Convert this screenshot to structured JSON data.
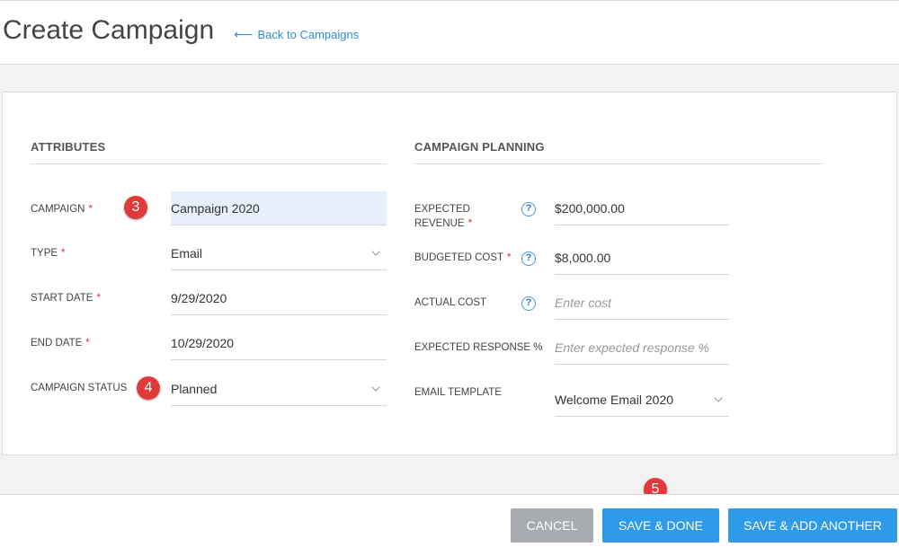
{
  "header": {
    "title": "Create Campaign",
    "back_arrow": "⟵",
    "back_label": "Back to Campaigns"
  },
  "attributes": {
    "section_title": "ATTRIBUTES",
    "required_mark": "*",
    "campaign": {
      "label": "CAMPAIGN",
      "value": "Campaign 2020"
    },
    "type": {
      "label": "TYPE",
      "value": "Email"
    },
    "start_date": {
      "label": "START DATE",
      "value": "9/29/2020"
    },
    "end_date": {
      "label": "END DATE",
      "value": "10/29/2020"
    },
    "campaign_status": {
      "label": "CAMPAIGN STATUS",
      "value": "Planned"
    }
  },
  "planning": {
    "section_title": "CAMPAIGN PLANNING",
    "help_glyph": "?",
    "expected_revenue": {
      "label_line1": "EXPECTED",
      "label_line2": "REVENUE",
      "value": "$200,000.00"
    },
    "budgeted_cost": {
      "label": "BUDGETED COST",
      "value": "$8,000.00"
    },
    "actual_cost": {
      "label": "ACTUAL COST",
      "placeholder": "Enter cost"
    },
    "expected_response": {
      "label": "EXPECTED RESPONSE %",
      "placeholder": "Enter expected response %"
    },
    "email_template": {
      "label": "EMAIL TEMPLATE",
      "value": "Welcome Email 2020"
    }
  },
  "badges": {
    "b3": "3",
    "b4": "4",
    "b5": "5"
  },
  "footer": {
    "cancel_label": "CANCEL",
    "save_done_label": "SAVE & DONE",
    "save_another_label": "SAVE & ADD ANOTHER"
  },
  "colors": {
    "accent": "#2f9be8",
    "link": "#2e8fd8",
    "badge": "#e23a3a",
    "required": "#e0303a",
    "highlight": "#e7effc"
  },
  "icons": {
    "back": "arrow-left-icon",
    "help": "help-icon",
    "dropdown": "chevron-down-icon"
  }
}
